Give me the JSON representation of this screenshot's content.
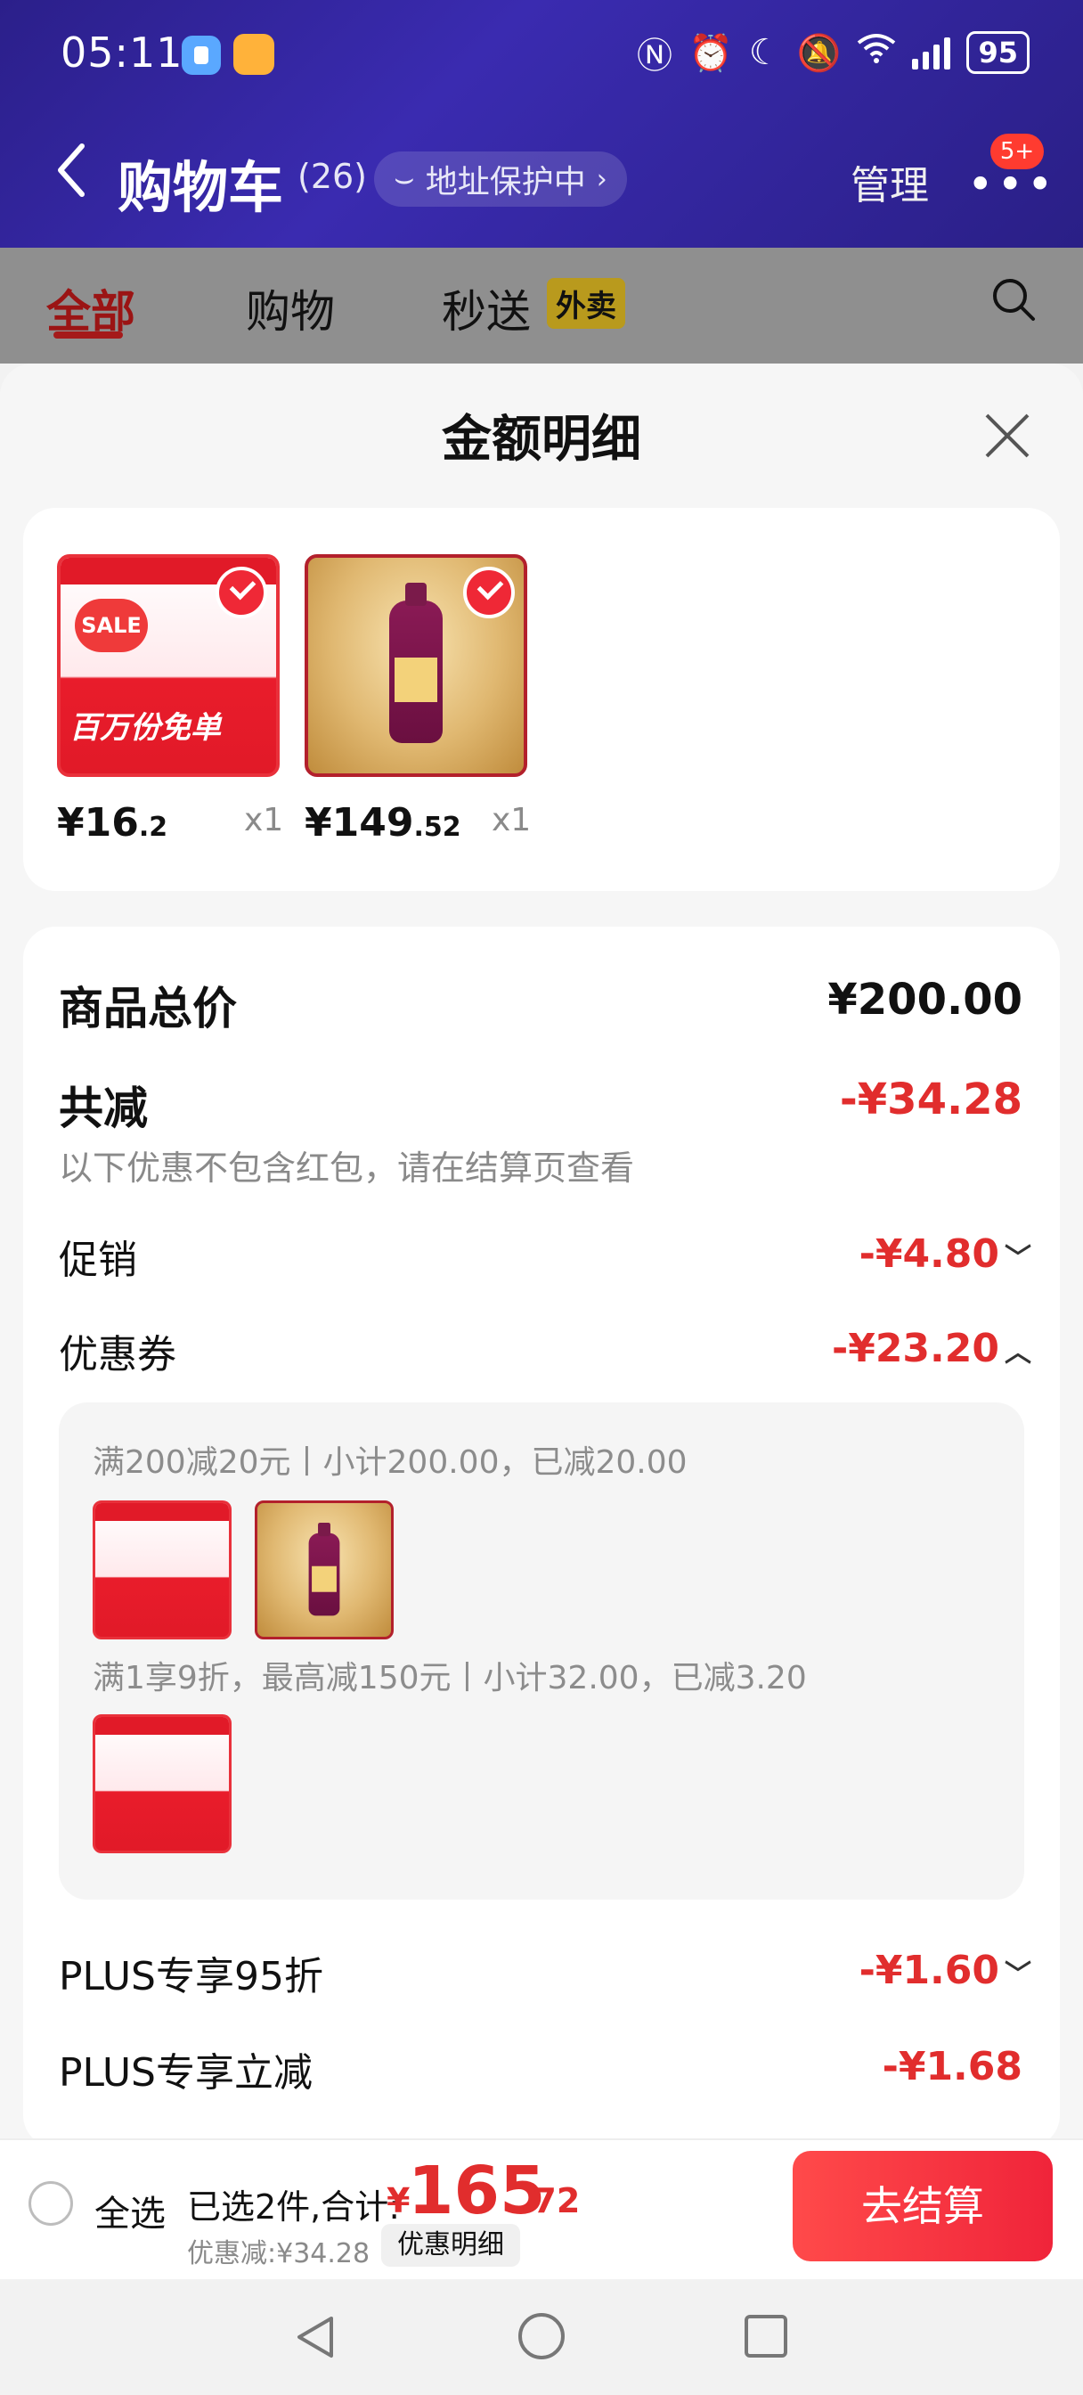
{
  "status_bar": {
    "time": "05:11",
    "battery": "95"
  },
  "header": {
    "title": "购物车",
    "count": "(26)",
    "address_pill": "地址保护中",
    "manage": "管理",
    "badge": "5+"
  },
  "tabs": [
    {
      "label": "全部"
    },
    {
      "label": "购物"
    },
    {
      "label": "秒送"
    }
  ],
  "tab_tag": "外卖",
  "sheet": {
    "title": "金额明细",
    "products": [
      {
        "price_int": "¥16",
        "price_dec": ".2",
        "qty": "x1",
        "banner": "百万份免单",
        "sale": "SALE"
      },
      {
        "price_int": "¥149",
        "price_dec": ".52",
        "qty": "x1"
      }
    ]
  },
  "summary": {
    "total_label": "商品总价",
    "total_value": "¥200.00",
    "reduce_label": "共减",
    "reduce_value": "-¥34.28",
    "reduce_note": "以下优惠不包含红包，请在结算页查看",
    "promo_label": "促销",
    "promo_value": "-¥4.80",
    "coupon_label": "优惠券",
    "coupon_value": "-¥23.20",
    "coupon_lines": [
      "满200减20元丨小计200.00，已减20.00",
      "满1享9折，最高减150元丨小计32.00，已减3.20"
    ],
    "plus95_label": "PLUS专享95折",
    "plus95_value": "-¥1.60",
    "plus_reduce_label": "PLUS专享立减",
    "plus_reduce_value": "-¥1.68"
  },
  "action_bar": {
    "select_all": "全选",
    "selected": "已选2件,合计:",
    "currency": "¥",
    "total_int": "165",
    "total_dec": ".72",
    "discount": "优惠减:¥34.28",
    "detail": "优惠明细",
    "checkout": "去结算"
  },
  "colors": {
    "accent_red": "#e12d2d",
    "header_purple": "#3a2bb0"
  }
}
